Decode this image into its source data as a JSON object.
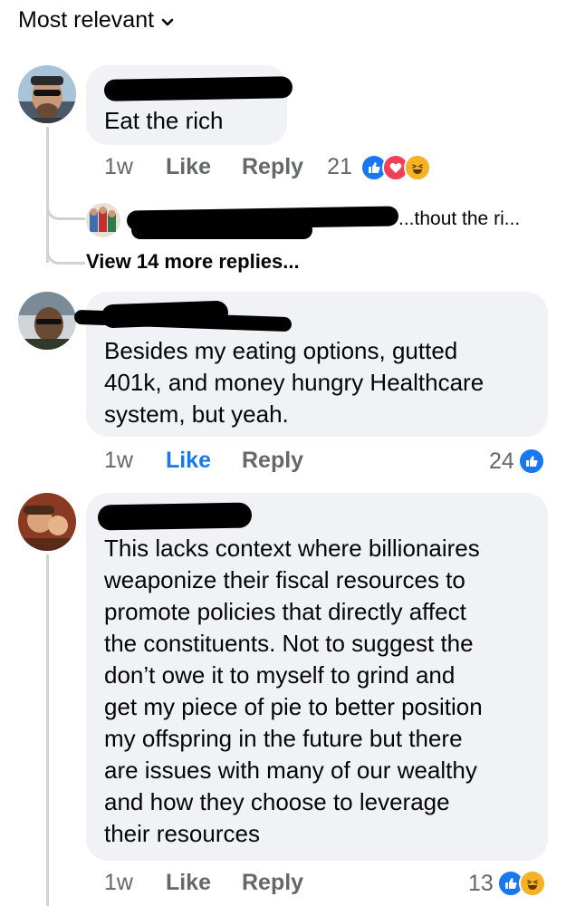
{
  "header": {
    "sort_label": "Most relevant"
  },
  "comments": [
    {
      "text": "Eat the rich",
      "time": "1w",
      "like": "Like",
      "reply": "Reply",
      "reaction_count": "21",
      "reactions": [
        "like-reaction-icon",
        "love-reaction-icon",
        "haha-reaction-icon"
      ],
      "reply_preview": "...thout the ri...",
      "view_more": "View 14 more replies..."
    },
    {
      "text_lines": [
        "Besides my eating options, gutted",
        "401k, and money hungry Healthcare",
        "system, but yeah."
      ],
      "time": "1w",
      "like": "Like",
      "reply": "Reply",
      "reaction_count": "24",
      "reactions": [
        "like-reaction-icon"
      ]
    },
    {
      "text_lines": [
        "This lacks context where billionaires",
        "weaponize their fiscal resources to",
        "promote policies that directly affect",
        "the constituents. Not to suggest the",
        "don’t owe it to myself to grind and",
        "get my piece of pie to better position",
        "my offspring in the future but there",
        "are issues with many of our wealthy",
        "and how they choose to leverage",
        "their resources"
      ],
      "time": "1w",
      "like": "Like",
      "reply": "Reply",
      "reaction_count": "13",
      "reactions": [
        "like-reaction-icon",
        "haha-reaction-icon"
      ]
    }
  ],
  "colors": {
    "like_blue": "#1877f2",
    "bubble": "#f0f2f5",
    "meta_gray": "#65676b"
  }
}
